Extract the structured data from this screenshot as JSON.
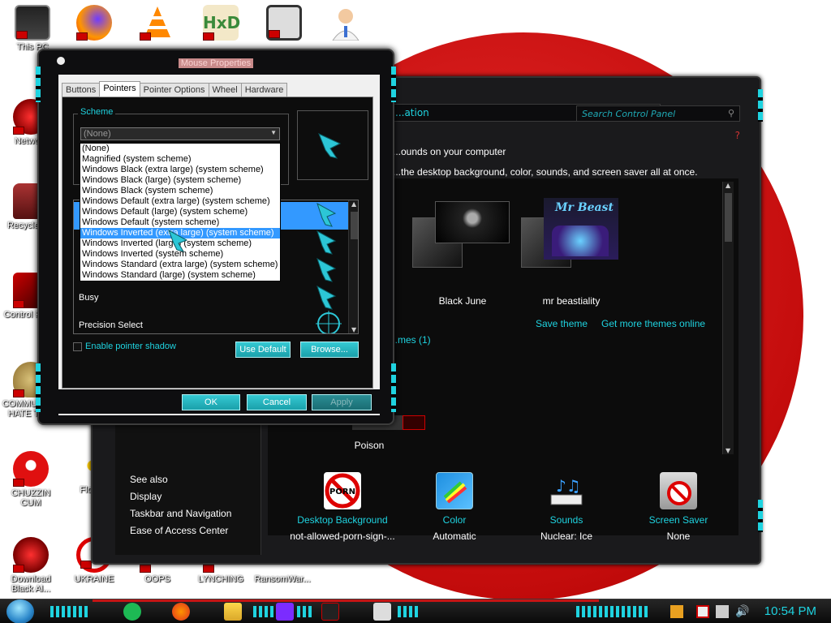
{
  "desktop_icons": [
    {
      "name": "this-pc",
      "label": "This PC"
    },
    {
      "name": "firefox",
      "label": ""
    },
    {
      "name": "vlc",
      "label": ""
    },
    {
      "name": "hxd",
      "label": ""
    },
    {
      "name": "app",
      "label": ""
    },
    {
      "name": "doctor",
      "label": ""
    },
    {
      "name": "network",
      "label": "Network"
    },
    {
      "name": "recycle-bin",
      "label": "Recycle Bin"
    },
    {
      "name": "control-panel",
      "label": "Control Panel"
    },
    {
      "name": "communism",
      "label": "COMMUNISM HATE THIS"
    },
    {
      "name": "chuzzin",
      "label": "CHUZZIN CUM"
    },
    {
      "name": "flower",
      "label": "Flo Ze"
    },
    {
      "name": "download",
      "label": "Download Black Al..."
    },
    {
      "name": "ukraine",
      "label": "UKRAINE"
    },
    {
      "name": "oops",
      "label": "OOPS"
    },
    {
      "name": "lynching",
      "label": "LYNCHING"
    },
    {
      "name": "ransomware",
      "label": "RansomWar..."
    }
  ],
  "control_panel": {
    "address": "...ation",
    "search_placeholder": "Search Control Panel",
    "heading": "...ounds on your computer",
    "subheading": "...the desktop background, color, sounds, and screen saver all at once.",
    "themes": [
      {
        "name": "Black June"
      },
      {
        "name": "mr beastiality"
      },
      {
        "name": "Poison"
      }
    ],
    "save_theme": "Save theme",
    "get_more_themes": "Get more themes online",
    "installed_themes": "...mes (1)",
    "see_also": {
      "title": "See also",
      "items": [
        "Display",
        "Taskbar and Navigation",
        "Ease of Access Center"
      ]
    },
    "bottom_items": [
      {
        "label": "Desktop Background",
        "value": "not-allowed-porn-sign-..."
      },
      {
        "label": "Color",
        "value": "Automatic"
      },
      {
        "label": "Sounds",
        "value": "Nuclear: Ice"
      },
      {
        "label": "Screen Saver",
        "value": "None"
      }
    ],
    "porn_sign_text": "PORN"
  },
  "mouse_properties": {
    "title": "Mouse Properties",
    "tabs": [
      "Buttons",
      "Pointers",
      "Pointer Options",
      "Wheel",
      "Hardware"
    ],
    "active_tab": "Pointers",
    "scheme_label": "Scheme",
    "scheme_value": "(None)",
    "scheme_options": [
      "(None)",
      "Magnified (system scheme)",
      "Windows Black (extra large) (system scheme)",
      "Windows Black (large) (system scheme)",
      "Windows Black (system scheme)",
      "Windows Default (extra large) (system scheme)",
      "Windows Default (large) (system scheme)",
      "Windows Default (system scheme)",
      "Windows Inverted (extra large) (system scheme)",
      "Windows Inverted (large) (system scheme)",
      "Windows Inverted (system scheme)",
      "Windows Standard (extra large) (system scheme)",
      "Windows Standard (large) (system scheme)"
    ],
    "selected_option_index": 8,
    "cursor_rows": [
      "Busy",
      "Precision Select"
    ],
    "enable_shadow": "Enable pointer shadow",
    "use_default": "Use Default",
    "browse": "Browse...",
    "ok": "OK",
    "cancel": "Cancel",
    "apply": "Apply"
  },
  "taskbar": {
    "clock": "10:54 PM"
  },
  "colors": {
    "accent": "#1fd3e0",
    "wallpaper_red": "#d81818",
    "selection": "#3399ff"
  }
}
